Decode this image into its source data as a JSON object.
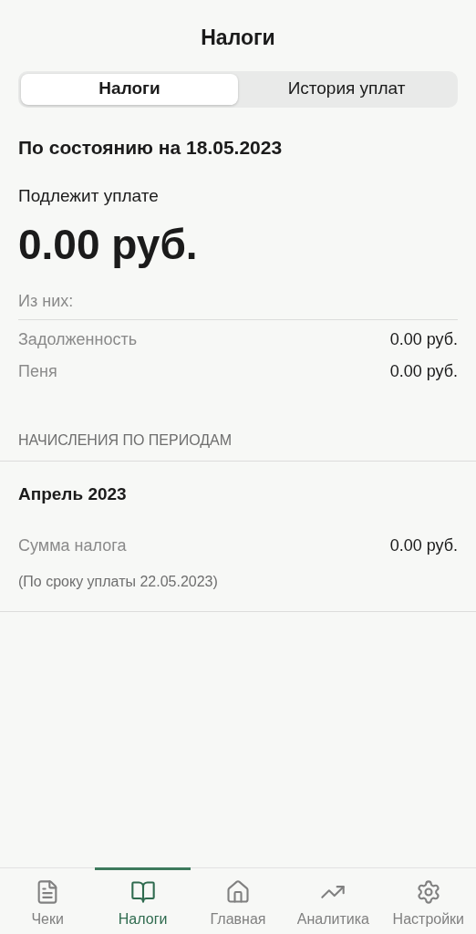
{
  "title": "Налоги",
  "tabs": [
    {
      "label": "Налоги",
      "selected": true
    },
    {
      "label": "История уплат",
      "selected": false
    }
  ],
  "as_of": "По состоянию на 18.05.2023",
  "due_label": "Подлежит уплате",
  "due_amount": "0.00 руб.",
  "breakdown_label": "Из них:",
  "breakdown": [
    {
      "label": "Задолженность",
      "value": "0.00 руб."
    },
    {
      "label": "Пеня",
      "value": "0.00 руб."
    }
  ],
  "section_title": "НАЧИСЛЕНИЯ ПО ПЕРИОДАМ",
  "periods": [
    {
      "title": "Апрель 2023",
      "label": "Сумма налога",
      "value": "0.00 руб.",
      "note": "(По сроку уплаты 22.05.2023)"
    }
  ],
  "nav": [
    {
      "kind": "receipt",
      "label": "Чеки",
      "selected": false
    },
    {
      "kind": "book",
      "label": "Налоги",
      "selected": true
    },
    {
      "kind": "home",
      "label": "Главная",
      "selected": false
    },
    {
      "kind": "chart",
      "label": "Аналитика",
      "selected": false
    },
    {
      "kind": "settings",
      "label": "Настройки",
      "selected": false
    }
  ]
}
